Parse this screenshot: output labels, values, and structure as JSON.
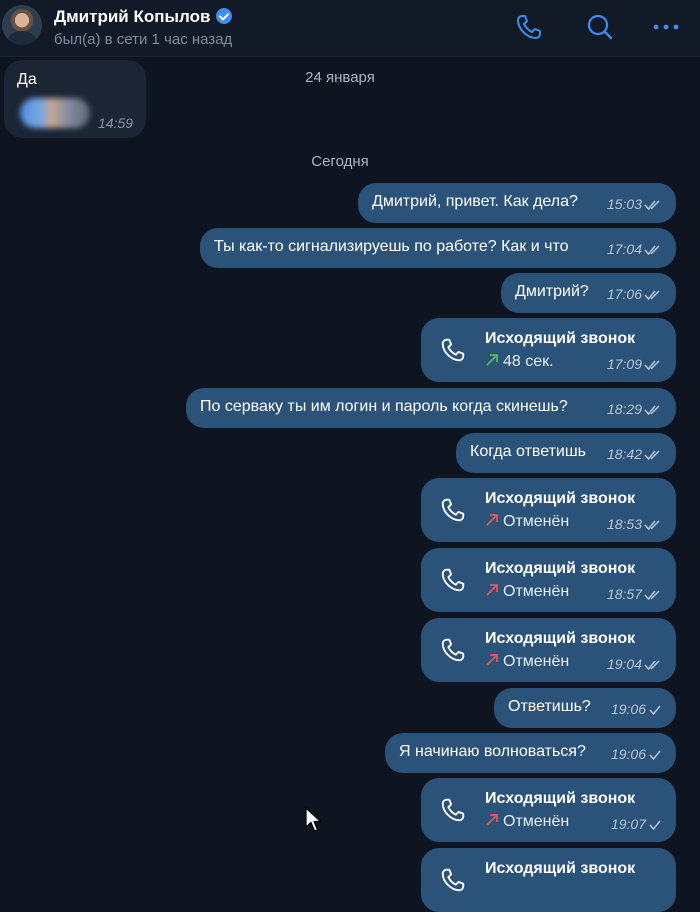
{
  "header": {
    "name": "Дмитрий Копылов",
    "status": "был(а) в сети 1 час назад",
    "icons": [
      "phone-icon",
      "search-icon",
      "more-icon"
    ]
  },
  "incoming": {
    "text": "Да",
    "time": "14:59"
  },
  "dates": {
    "jan24": "24 января",
    "today": "Сегодня"
  },
  "messages": [
    {
      "type": "text",
      "text": "Дмитрий, привет. Как дела?",
      "time": "15:03",
      "read": true
    },
    {
      "type": "text",
      "text": "Ты как-то сигнализируешь по работе? Как и что",
      "time": "17:04",
      "read": true
    },
    {
      "type": "text",
      "text": "Дмитрий?",
      "time": "17:06",
      "read": true
    },
    {
      "type": "call",
      "title": "Исходящий звонок",
      "status": "48 сек.",
      "status_kind": "answered",
      "time": "17:09",
      "read": true
    },
    {
      "type": "text",
      "text": "По серваку ты им логин и пароль когда скинешь?",
      "time": "18:29",
      "read": true
    },
    {
      "type": "text",
      "text": "Когда ответишь",
      "time": "18:42",
      "read": true
    },
    {
      "type": "call",
      "title": "Исходящий звонок",
      "status": "Отменён",
      "status_kind": "cancelled",
      "time": "18:53",
      "read": true
    },
    {
      "type": "call",
      "title": "Исходящий звонок",
      "status": "Отменён",
      "status_kind": "cancelled",
      "time": "18:57",
      "read": true
    },
    {
      "type": "call",
      "title": "Исходящий звонок",
      "status": "Отменён",
      "status_kind": "cancelled",
      "time": "19:04",
      "read": true
    },
    {
      "type": "text",
      "text": "Ответишь?",
      "time": "19:06",
      "read": false
    },
    {
      "type": "text",
      "text": "Я начинаю волноваться?",
      "time": "19:06",
      "read": false
    },
    {
      "type": "call",
      "title": "Исходящий звонок",
      "status": "Отменён",
      "status_kind": "cancelled",
      "time": "19:07",
      "read": false
    },
    {
      "type": "call",
      "title": "Исходящий звонок",
      "status": "",
      "status_kind": "",
      "time": "",
      "read": false
    }
  ],
  "colors": {
    "background": "#0e1420",
    "outgoing_bubble": "#2b5278",
    "incoming_bubble": "#1c2533",
    "accent": "#3d8cf0",
    "answered_arrow": "#4fbf5a",
    "cancelled_arrow": "#e0585a"
  }
}
